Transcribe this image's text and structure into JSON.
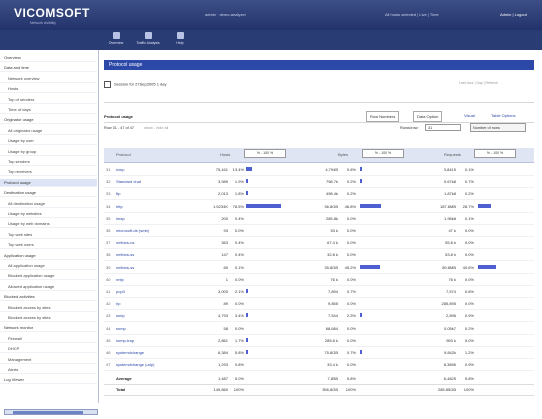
{
  "app": {
    "logo": "VICOMSOFT",
    "logo_tag": "Network visibility",
    "top_center": "admin · demo-analyzer",
    "top_right": "All hosts selected | Live | Time",
    "top_links": "Admin | Logout"
  },
  "toolbar": {
    "items": [
      {
        "label": "Overview",
        "icon": "home-icon"
      },
      {
        "label": "Traffic Analysis",
        "icon": "chart-icon"
      },
      {
        "label": "Help",
        "icon": "help-icon"
      }
    ]
  },
  "sidebar": {
    "items": [
      {
        "label": "Overview",
        "level": 0
      },
      {
        "label": "Data and time",
        "level": 0
      },
      {
        "label": "Network overview",
        "level": 1
      },
      {
        "label": "Hosts",
        "level": 1
      },
      {
        "label": "Top of senders",
        "level": 1
      },
      {
        "label": "Time of days",
        "level": 1
      },
      {
        "label": "Originator usage",
        "level": 0
      },
      {
        "label": "All originator usage",
        "level": 1
      },
      {
        "label": "Usage by user",
        "level": 1
      },
      {
        "label": "Usage by group",
        "level": 1
      },
      {
        "label": "Top senders",
        "level": 1
      },
      {
        "label": "Top receivers",
        "level": 1
      },
      {
        "label": "Protocol usage",
        "level": 0,
        "selected": true
      },
      {
        "label": "Destination usage",
        "level": 0
      },
      {
        "label": "All destination usage",
        "level": 1
      },
      {
        "label": "Usage by websites",
        "level": 1
      },
      {
        "label": "Usage by web domains",
        "level": 1
      },
      {
        "label": "Top web sites",
        "level": 1
      },
      {
        "label": "Top web users",
        "level": 1
      },
      {
        "label": "Application usage",
        "level": 0
      },
      {
        "label": "All application usage",
        "level": 1
      },
      {
        "label": "Blocked application usage",
        "level": 1
      },
      {
        "label": "Allowed application usage",
        "level": 1
      },
      {
        "label": "Blocked activities",
        "level": 0
      },
      {
        "label": "Blocked access by sites",
        "level": 1
      },
      {
        "label": "Blocked access by sites",
        "level": 1
      },
      {
        "label": "Network monitor",
        "level": 0
      },
      {
        "label": "Firewall",
        "level": 1
      },
      {
        "label": "DHCP",
        "level": 1
      },
      {
        "label": "Management",
        "level": 1
      },
      {
        "label": "Alerts",
        "level": 1
      },
      {
        "label": "Log Viewer",
        "level": 0
      }
    ]
  },
  "main": {
    "section_title": "Protocol usage",
    "session_line": "Session for 27Sep2005 1 day",
    "session_right": "Last hour | Day | Refresh",
    "panel_title": "Protocol usage",
    "tabs": [
      {
        "label": "Row Numbers",
        "kind": "tab"
      },
      {
        "label": "Data Option",
        "kind": "tab"
      },
      {
        "label": "Visual",
        "kind": "link"
      },
      {
        "label": "Table Options",
        "kind": "link"
      }
    ],
    "rows_info": "Row 31 - 47 of 47",
    "rows_link": "show - hide all",
    "rows_label": "Rows/row:",
    "rows_value": "31",
    "rows_select": "Number of rows",
    "columns": {
      "name": "Protocol",
      "hosts": "Hosts",
      "bytes": "Bytes",
      "requests": "Requests",
      "pct_select": "% - 100 %"
    },
    "rows": [
      {
        "n": "31",
        "name": "icmp",
        "hosts": "75,441",
        "hp": "13.4%",
        "hbar": 0.13,
        "bytes": "4,794B",
        "bp": "0.6%",
        "bbar": 0.01,
        "req": "3,8415",
        "rp": "0.1%",
        "rbar": 0
      },
      {
        "n": "32",
        "name": "Standard chat",
        "hosts": "3,989",
        "hp": "1.9%",
        "hbar": 0.02,
        "bytes": "798.7k",
        "bp": "0.2%",
        "bbar": 0.002,
        "req": "0.67k8",
        "rp": "0.7%",
        "rbar": 0
      },
      {
        "n": "33",
        "name": "ftp",
        "hosts": "2,013",
        "hp": "1.8%",
        "hbar": 0.02,
        "bytes": "498.4k",
        "bp": "0.2%",
        "bbar": 0,
        "req": "1.87k8",
        "rp": "0.2%",
        "rbar": 0
      },
      {
        "n": "34",
        "name": "http",
        "hosts": "1.5234K",
        "hp": "78.5%",
        "hbar": 0.78,
        "bytes": "36.8GB",
        "bp": "46.8%",
        "bbar": 0.47,
        "req": "187.6MB",
        "rp": "28.7%",
        "rbar": 0.29
      },
      {
        "n": "35",
        "name": "imap",
        "hosts": "200",
        "hp": "0.4%",
        "hbar": 0,
        "bytes": "285.8k",
        "bp": "0.0%",
        "bbar": 0,
        "req": "1.96k8",
        "rp": "0.1%",
        "rbar": 0
      },
      {
        "n": "36",
        "name": "microsoft-ds (smb)",
        "hosts": "93",
        "hp": "0.0%",
        "hbar": 0,
        "bytes": "53 k",
        "bp": "0.0%",
        "bbar": 0,
        "req": "47 k",
        "rp": "0.0%",
        "rbar": 0
      },
      {
        "n": "37",
        "name": "netbios-ns",
        "hosts": "363",
        "hp": "0.4%",
        "hbar": 0,
        "bytes": "67.4 k",
        "bp": "0.0%",
        "bbar": 0,
        "req": "55.8 k",
        "rp": "0.0%",
        "rbar": 0
      },
      {
        "n": "38",
        "name": "netbios-ss",
        "hosts": "147",
        "hp": "0.4%",
        "hbar": 0,
        "bytes": "32.8 k",
        "bp": "0.0%",
        "bbar": 0,
        "req": "53.8 k",
        "rp": "0.0%",
        "rbar": 0
      },
      {
        "n": "39",
        "name": "netbios-ss",
        "hosts": "69",
        "hp": "0.1%",
        "hbar": 0,
        "bytes": "35.8GB",
        "bp": "45.2%",
        "bbar": 0.45,
        "req": "89.8MB",
        "rp": "40.6%",
        "rbar": 0.41
      },
      {
        "n": "40",
        "name": "nntp",
        "hosts": "1",
        "hp": "0.0%",
        "hbar": 0,
        "bytes": "76 k",
        "bp": "0.0%",
        "bbar": 0,
        "req": "76 k",
        "rp": "0.0%",
        "rbar": 0
      },
      {
        "n": "41",
        "name": "pop3",
        "hosts": "3,000",
        "hp": "2.1%",
        "hbar": 0.02,
        "bytes": "7,894",
        "bp": "0.7%",
        "bbar": 0,
        "req": "7,574",
        "rp": "0.8%",
        "rbar": 0
      },
      {
        "n": "42",
        "name": "rip",
        "hosts": "89",
        "hp": "0.0%",
        "hbar": 0,
        "bytes": "9,855",
        "bp": "0.0%",
        "bbar": 0,
        "req": "285,895",
        "rp": "0.0%",
        "rbar": 0
      },
      {
        "n": "43",
        "name": "smtp",
        "hosts": "4,793",
        "hp": "3.4%",
        "hbar": 0.03,
        "bytes": "7,544",
        "bp": "2.3%",
        "bbar": 0.02,
        "req": "2,896",
        "rp": "0.9%",
        "rbar": 0
      },
      {
        "n": "44",
        "name": "snmp",
        "hosts": "58",
        "hp": "0.0%",
        "hbar": 0,
        "bytes": "68,684",
        "bp": "0.0%",
        "bbar": 0,
        "req": "0.05k7",
        "rp": "0.2%",
        "rbar": 0
      },
      {
        "n": "45",
        "name": "snmp-trap",
        "hosts": "2,861",
        "hp": "1.7%",
        "hbar": 0.02,
        "bytes": "285.8 k",
        "bp": "0.0%",
        "bbar": 0,
        "req": "953 k",
        "rp": "0.0%",
        "rbar": 0
      },
      {
        "n": "46",
        "name": "systemdchange",
        "hosts": "6,384",
        "hp": "5.8%",
        "hbar": 0.05,
        "bytes": "75.8GB",
        "bp": "0.7%",
        "bbar": 0.01,
        "req": "9.842k",
        "rp": "1.2%",
        "rbar": 0
      },
      {
        "n": "47",
        "name": "systemdchange (udp)",
        "hosts": "1,293",
        "hp": "0.8%",
        "hbar": 0,
        "bytes": "33.4 k",
        "bp": "0.0%",
        "bbar": 0,
        "req": "8,3896",
        "rp": "0.9%",
        "rbar": 0
      }
    ],
    "summary": [
      {
        "label": "Average",
        "hosts": "1,487",
        "hp": "5.0%",
        "bytes": "7,85B",
        "bp": "5.8%",
        "req": "6,4825",
        "rp": "5.8%"
      },
      {
        "label": "Total",
        "hosts": "149,860",
        "hp": "100%",
        "bytes": "356,8GB",
        "bp": "100%",
        "req": "285.85GB",
        "rp": "100%"
      }
    ]
  },
  "colors": {
    "brand": "#23326a",
    "accent": "#2c49a7",
    "bar": "#4d5fd1"
  }
}
